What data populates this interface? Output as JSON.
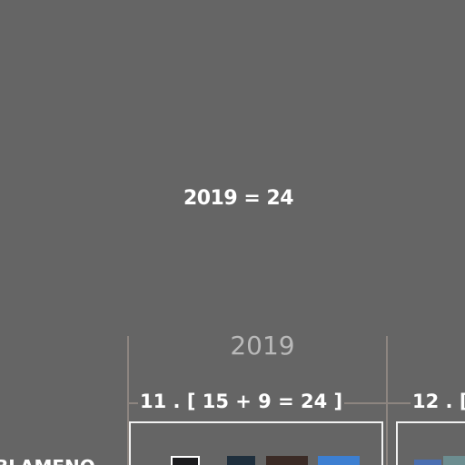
{
  "summary": {
    "text": "2019 = 24"
  },
  "timeline": {
    "year": "2019",
    "groups": [
      {
        "title": "11 . [ 15 + 9 = 24 ]",
        "thumbnails": [
          {
            "name": "dark-photo-thumbnail",
            "color": "#1c1c1e",
            "border": "#ffffff"
          },
          {
            "name": "night-photo-thumbnail",
            "color": "#1f2f3d",
            "border": ""
          },
          {
            "name": "brown-photo-thumbnail",
            "color": "#3b2b26",
            "border": ""
          },
          {
            "name": "blue-photo-thumbnail",
            "color": "#3d7fd1",
            "border": ""
          }
        ]
      },
      {
        "title": "12 . [ ",
        "thumbnails": [
          {
            "name": "sky-photo-thumbnail",
            "color": "#4a6fb0",
            "border": ""
          },
          {
            "name": "teal-photo-thumbnail",
            "color": "#6c8d90",
            "border": ""
          }
        ]
      }
    ]
  },
  "sidebar": {
    "partial_label": "BLAMENO"
  }
}
